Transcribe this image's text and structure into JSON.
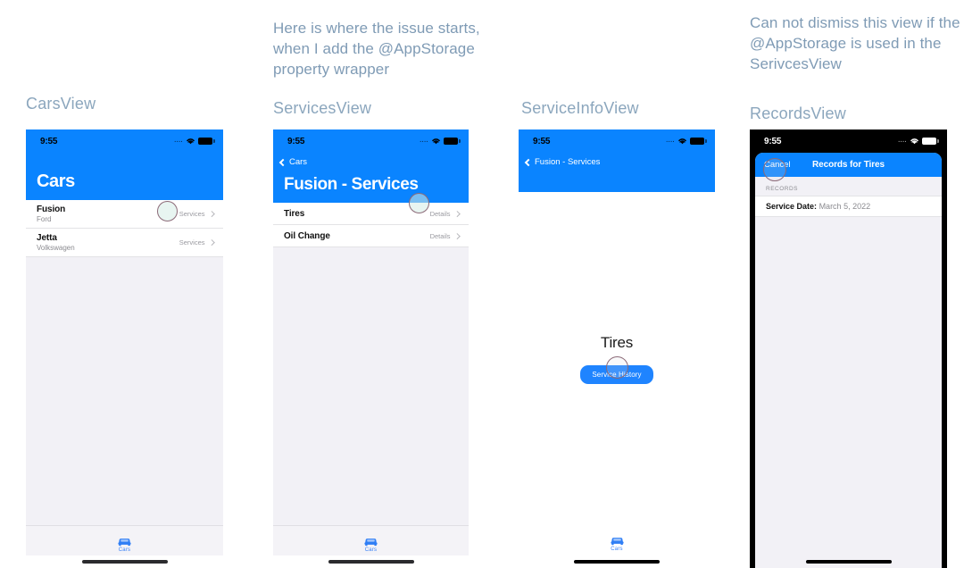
{
  "annotations": {
    "services_note": "Here is where the issue starts, when I add the @AppStorage property wrapper",
    "records_note": "Can not dismiss this view if the @AppStorage is used in the SerivcesView"
  },
  "panels": [
    {
      "view_label": "CarsView",
      "status_bar": {
        "time": "9:55",
        "signal": "....",
        "wifi_icon": "wifi-icon",
        "battery_icon": "battery-icon"
      },
      "nav": {
        "title": "Cars",
        "back_label": null
      },
      "rows": [
        {
          "title": "Fusion",
          "subtitle": "Ford",
          "action": "Services",
          "chevron": "chevron-right-icon"
        },
        {
          "title": "Jetta",
          "subtitle": "Volkswagen",
          "action": "Services",
          "chevron": "chevron-right-icon"
        }
      ],
      "tabbar": {
        "icon": "car-icon",
        "label": "Cars"
      }
    },
    {
      "view_label": "ServicesView",
      "status_bar": {
        "time": "9:55",
        "signal": "....",
        "wifi_icon": "wifi-icon",
        "battery_icon": "battery-icon"
      },
      "nav": {
        "title": "Fusion - Services",
        "back_label": "Cars"
      },
      "rows": [
        {
          "title": "Tires",
          "subtitle": null,
          "action": "Details",
          "chevron": "chevron-right-icon"
        },
        {
          "title": "Oil Change",
          "subtitle": null,
          "action": "Details",
          "chevron": "chevron-right-icon"
        }
      ],
      "tabbar": {
        "icon": "car-icon",
        "label": "Cars"
      }
    },
    {
      "view_label": "ServiceInfoView",
      "status_bar": {
        "time": "9:55",
        "signal": "....",
        "wifi_icon": "wifi-icon",
        "battery_icon": "battery-icon"
      },
      "nav": {
        "title": null,
        "back_label": "Fusion - Services"
      },
      "body": {
        "heading": "Tires",
        "button_label": "Service History"
      },
      "tabbar": {
        "icon": "car-icon",
        "label": "Cars"
      }
    },
    {
      "view_label": "RecordsView",
      "status_bar": {
        "time": "9:55",
        "signal": "....",
        "wifi_icon": "wifi-icon",
        "battery_icon": "battery-icon"
      },
      "sheet": {
        "cancel_label": "Cancel",
        "title": "Records for Tires",
        "section_header": "RECORDS",
        "record_key": "Service Date:",
        "record_value": "March 5, 2022"
      }
    }
  ],
  "colors": {
    "accent_blue": "#0a84ff",
    "button_blue": "#1f84ff",
    "note_text": "#7f9bb5",
    "label_text": "#8ba6bd",
    "list_bg": "#f2f1f6",
    "sheet_backdrop": "#000000"
  }
}
